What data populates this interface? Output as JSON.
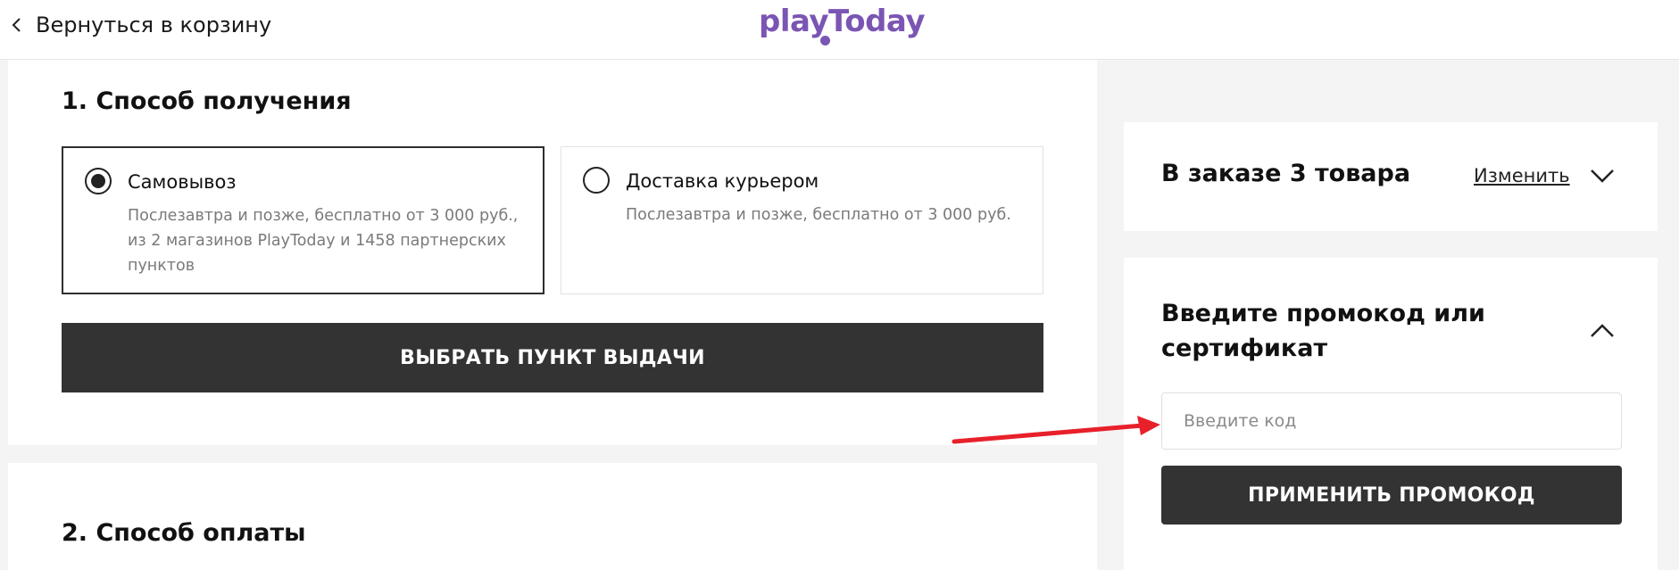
{
  "header": {
    "back_label": "Вернуться в корзину",
    "logo_text": "playToday",
    "logo_color": "#7b55b3"
  },
  "delivery": {
    "title": "1. Способ получения",
    "options": [
      {
        "title": "Самовывоз",
        "description": "Послезавтра и позже, бесплатно от 3 000 руб., из 2 магазинов PlayToday и 1458 партнерских пунктов",
        "selected": true
      },
      {
        "title": "Доставка курьером",
        "description": "Послезавтра и позже, бесплатно от 3 000 руб.",
        "selected": false
      }
    ],
    "pickup_button": "ВЫБРАТЬ ПУНКТ ВЫДАЧИ"
  },
  "payment": {
    "title": "2. Способ оплаты"
  },
  "order_summary": {
    "title": "В заказе 3 товара",
    "change_label": "Изменить"
  },
  "promo": {
    "title": "Введите промокод или сертификат",
    "input_placeholder": "Введите код",
    "input_value": "",
    "apply_button": "ПРИМЕНИТЬ ПРОМОКОД"
  },
  "colors": {
    "dark_button": "#333333",
    "annotation_arrow": "#e8202a",
    "page_bg": "#f4f4f4"
  }
}
